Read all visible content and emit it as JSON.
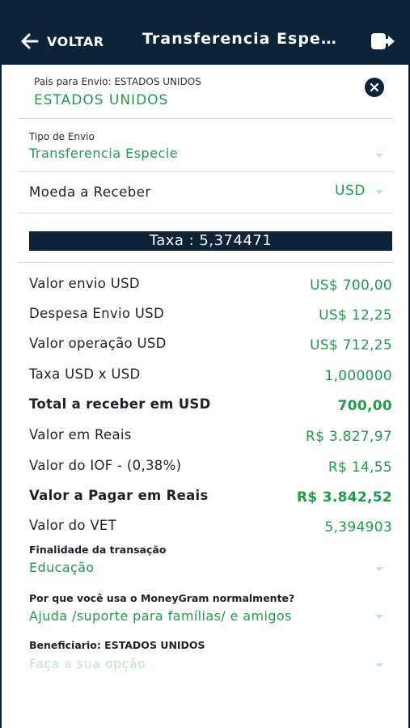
{
  "header": {
    "back_label": "VOLTAR",
    "title": "Transferencia Especie"
  },
  "country": {
    "label": "Pais para Envio: ESTADOS UNIDOS",
    "value": "ESTADOS UNIDOS"
  },
  "send_type": {
    "label": "Tipo de Envio",
    "value": "Transferencia Especie"
  },
  "currency": {
    "label": "Moeda a Receber",
    "value": "USD"
  },
  "rate": {
    "text": "Taxa : 5,374471"
  },
  "summary": [
    {
      "label": "Valor envio USD",
      "value": "US$ 700,00",
      "bold": false
    },
    {
      "label": "Despesa Envio USD",
      "value": "US$ 12,25",
      "bold": false
    },
    {
      "label": "Valor operação USD",
      "value": "US$ 712,25",
      "bold": false
    },
    {
      "label": "Taxa USD x USD",
      "value": "1,000000",
      "bold": false
    },
    {
      "label": "Total a receber em USD",
      "value": "700,00",
      "bold": true
    },
    {
      "label": "Valor em Reais",
      "value": "R$ 3.827,97",
      "bold": false
    },
    {
      "label": "Valor do IOF - (0,38%)",
      "value": "R$ 14,55",
      "bold": false
    },
    {
      "label": "Valor a Pagar em Reais",
      "value": "R$ 3.842,52",
      "bold": true
    },
    {
      "label": "Valor do VET",
      "value": "5,394903",
      "bold": false
    }
  ],
  "purpose": {
    "label": "Finalidade da transação",
    "value": "Educação"
  },
  "reason": {
    "label": "Por que você usa o MoneyGram normalmente?",
    "value": "Ajuda /suporte para famílias/ e amigos"
  },
  "beneficiary": {
    "label": "Beneficiario: ESTADOS UNIDOS",
    "placeholder": "Faça a sua opção"
  },
  "colors": {
    "header_bg": "#0e2238",
    "accent_green": "#1f9c4a",
    "placeholder_green": "#bfe6cc"
  },
  "icons": [
    "arrow-left-icon",
    "logout-icon",
    "close-icon",
    "chevron-down-icon"
  ]
}
